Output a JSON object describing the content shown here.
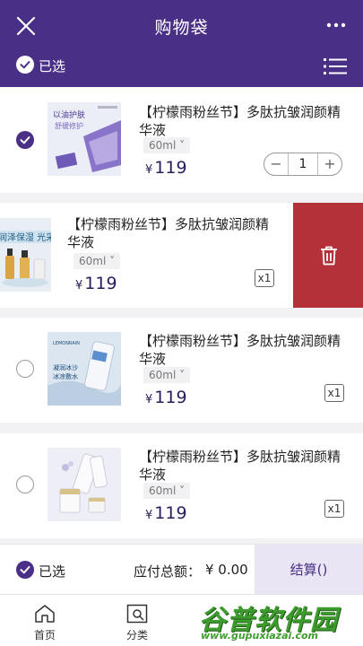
{
  "header": {
    "title": "购物袋",
    "selected_label": "已选",
    "close_icon": "close-icon",
    "more_icon": "more-icon",
    "list_icon": "list-icon"
  },
  "items": [
    {
      "title": "【柠檬雨粉丝节】多肽抗皱润颜精华液",
      "spec": "60ml",
      "currency": "¥",
      "price": "119",
      "quantity": "1",
      "checked": true,
      "image_text": [
        "以油护肤",
        "舒缓修护"
      ]
    },
    {
      "title": "【柠檬雨粉丝节】多肽抗皱润颜精华液",
      "spec": "60ml",
      "currency": "¥",
      "price": "119",
      "quantity_badge": "x1",
      "image_text": [
        "润泽保湿 光采焕亮"
      ]
    },
    {
      "title": "【柠檬雨粉丝节】多肽抗皱润颜精华液",
      "spec": "60ml",
      "currency": "¥",
      "price": "119",
      "quantity_badge": "x1",
      "image_text": [
        "凝润冰沙",
        "冰凉敷水"
      ]
    },
    {
      "title": "【柠檬雨粉丝节】多肽抗皱润颜精华液",
      "spec": "60ml",
      "currency": "¥",
      "price": "119",
      "quantity_badge": "x1",
      "image_text": []
    }
  ],
  "footer": {
    "selected_label": "已选",
    "total_label": "应付总额：",
    "total_value": "¥ 0.00",
    "checkout_label": "结算()"
  },
  "tabbar": {
    "tabs": [
      {
        "label": "首页",
        "icon": "home-icon"
      },
      {
        "label": "分类",
        "icon": "category-search-icon"
      }
    ]
  },
  "watermark": {
    "text": "谷普软件园",
    "url": "www.gupuxiazai.com"
  },
  "colors": {
    "brand": "#4a2f86",
    "delete": "#b5313a",
    "price": "#2d1c5c"
  }
}
